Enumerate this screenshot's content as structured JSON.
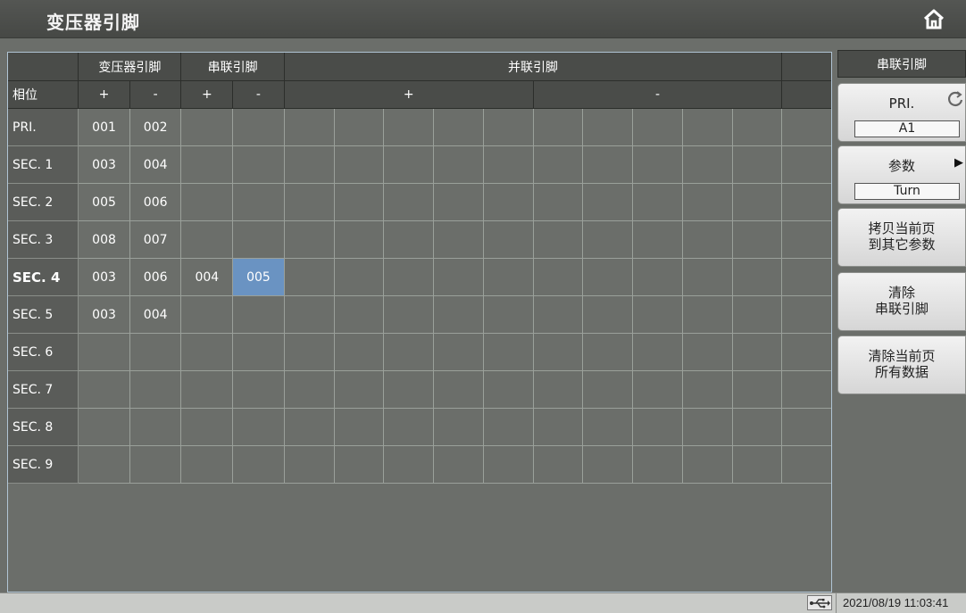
{
  "window": {
    "title": "变压器引脚"
  },
  "header": {
    "row1": {
      "transformer": "变压器引脚",
      "series": "串联引脚",
      "parallel": "并联引脚"
    },
    "row2": {
      "phase": "相位",
      "plus": "+",
      "minus": "-"
    }
  },
  "rows": [
    {
      "label": "PRI.",
      "cells": [
        "001",
        "002",
        "",
        "",
        "",
        "",
        "",
        "",
        "",
        "",
        "",
        "",
        "",
        "",
        ""
      ]
    },
    {
      "label": "SEC. 1",
      "cells": [
        "003",
        "004",
        "",
        "",
        "",
        "",
        "",
        "",
        "",
        "",
        "",
        "",
        "",
        "",
        ""
      ]
    },
    {
      "label": "SEC. 2",
      "cells": [
        "005",
        "006",
        "",
        "",
        "",
        "",
        "",
        "",
        "",
        "",
        "",
        "",
        "",
        "",
        ""
      ]
    },
    {
      "label": "SEC. 3",
      "cells": [
        "008",
        "007",
        "",
        "",
        "",
        "",
        "",
        "",
        "",
        "",
        "",
        "",
        "",
        "",
        ""
      ]
    },
    {
      "label": "SEC. 4",
      "cells": [
        "003",
        "006",
        "004",
        "005",
        "",
        "",
        "",
        "",
        "",
        "",
        "",
        "",
        "",
        "",
        ""
      ]
    },
    {
      "label": "SEC. 5",
      "cells": [
        "003",
        "004",
        "",
        "",
        "",
        "",
        "",
        "",
        "",
        "",
        "",
        "",
        "",
        "",
        ""
      ]
    },
    {
      "label": "SEC. 6",
      "cells": [
        "",
        "",
        "",
        "",
        "",
        "",
        "",
        "",
        "",
        "",
        "",
        "",
        "",
        "",
        ""
      ]
    },
    {
      "label": "SEC. 7",
      "cells": [
        "",
        "",
        "",
        "",
        "",
        "",
        "",
        "",
        "",
        "",
        "",
        "",
        "",
        "",
        ""
      ]
    },
    {
      "label": "SEC. 8",
      "cells": [
        "",
        "",
        "",
        "",
        "",
        "",
        "",
        "",
        "",
        "",
        "",
        "",
        "",
        "",
        ""
      ]
    },
    {
      "label": "SEC. 9",
      "cells": [
        "",
        "",
        "",
        "",
        "",
        "",
        "",
        "",
        "",
        "",
        "",
        "",
        "",
        "",
        ""
      ]
    }
  ],
  "selection": {
    "row": 4,
    "col": 3
  },
  "sidebar": {
    "title": "串联引脚",
    "buttons": [
      {
        "label": "PRI.",
        "value": "A1"
      },
      {
        "label": "参数",
        "value": "Turn"
      },
      {
        "label": "拷贝当前页\n到其它参数"
      },
      {
        "label": "清除\n串联引脚"
      },
      {
        "label": "清除当前页\n所有数据"
      }
    ]
  },
  "status": {
    "datetime": "2021/08/19 11:03:41"
  },
  "colors": {
    "background": "#6b6e6a",
    "header": "#4a4c49",
    "selected": "#6a93c2",
    "grid_line": "#9aa09a"
  },
  "icons": {
    "home": "home-icon",
    "refresh": "refresh-icon",
    "arrow": "arrow-right-icon",
    "usb": "usb-icon"
  }
}
